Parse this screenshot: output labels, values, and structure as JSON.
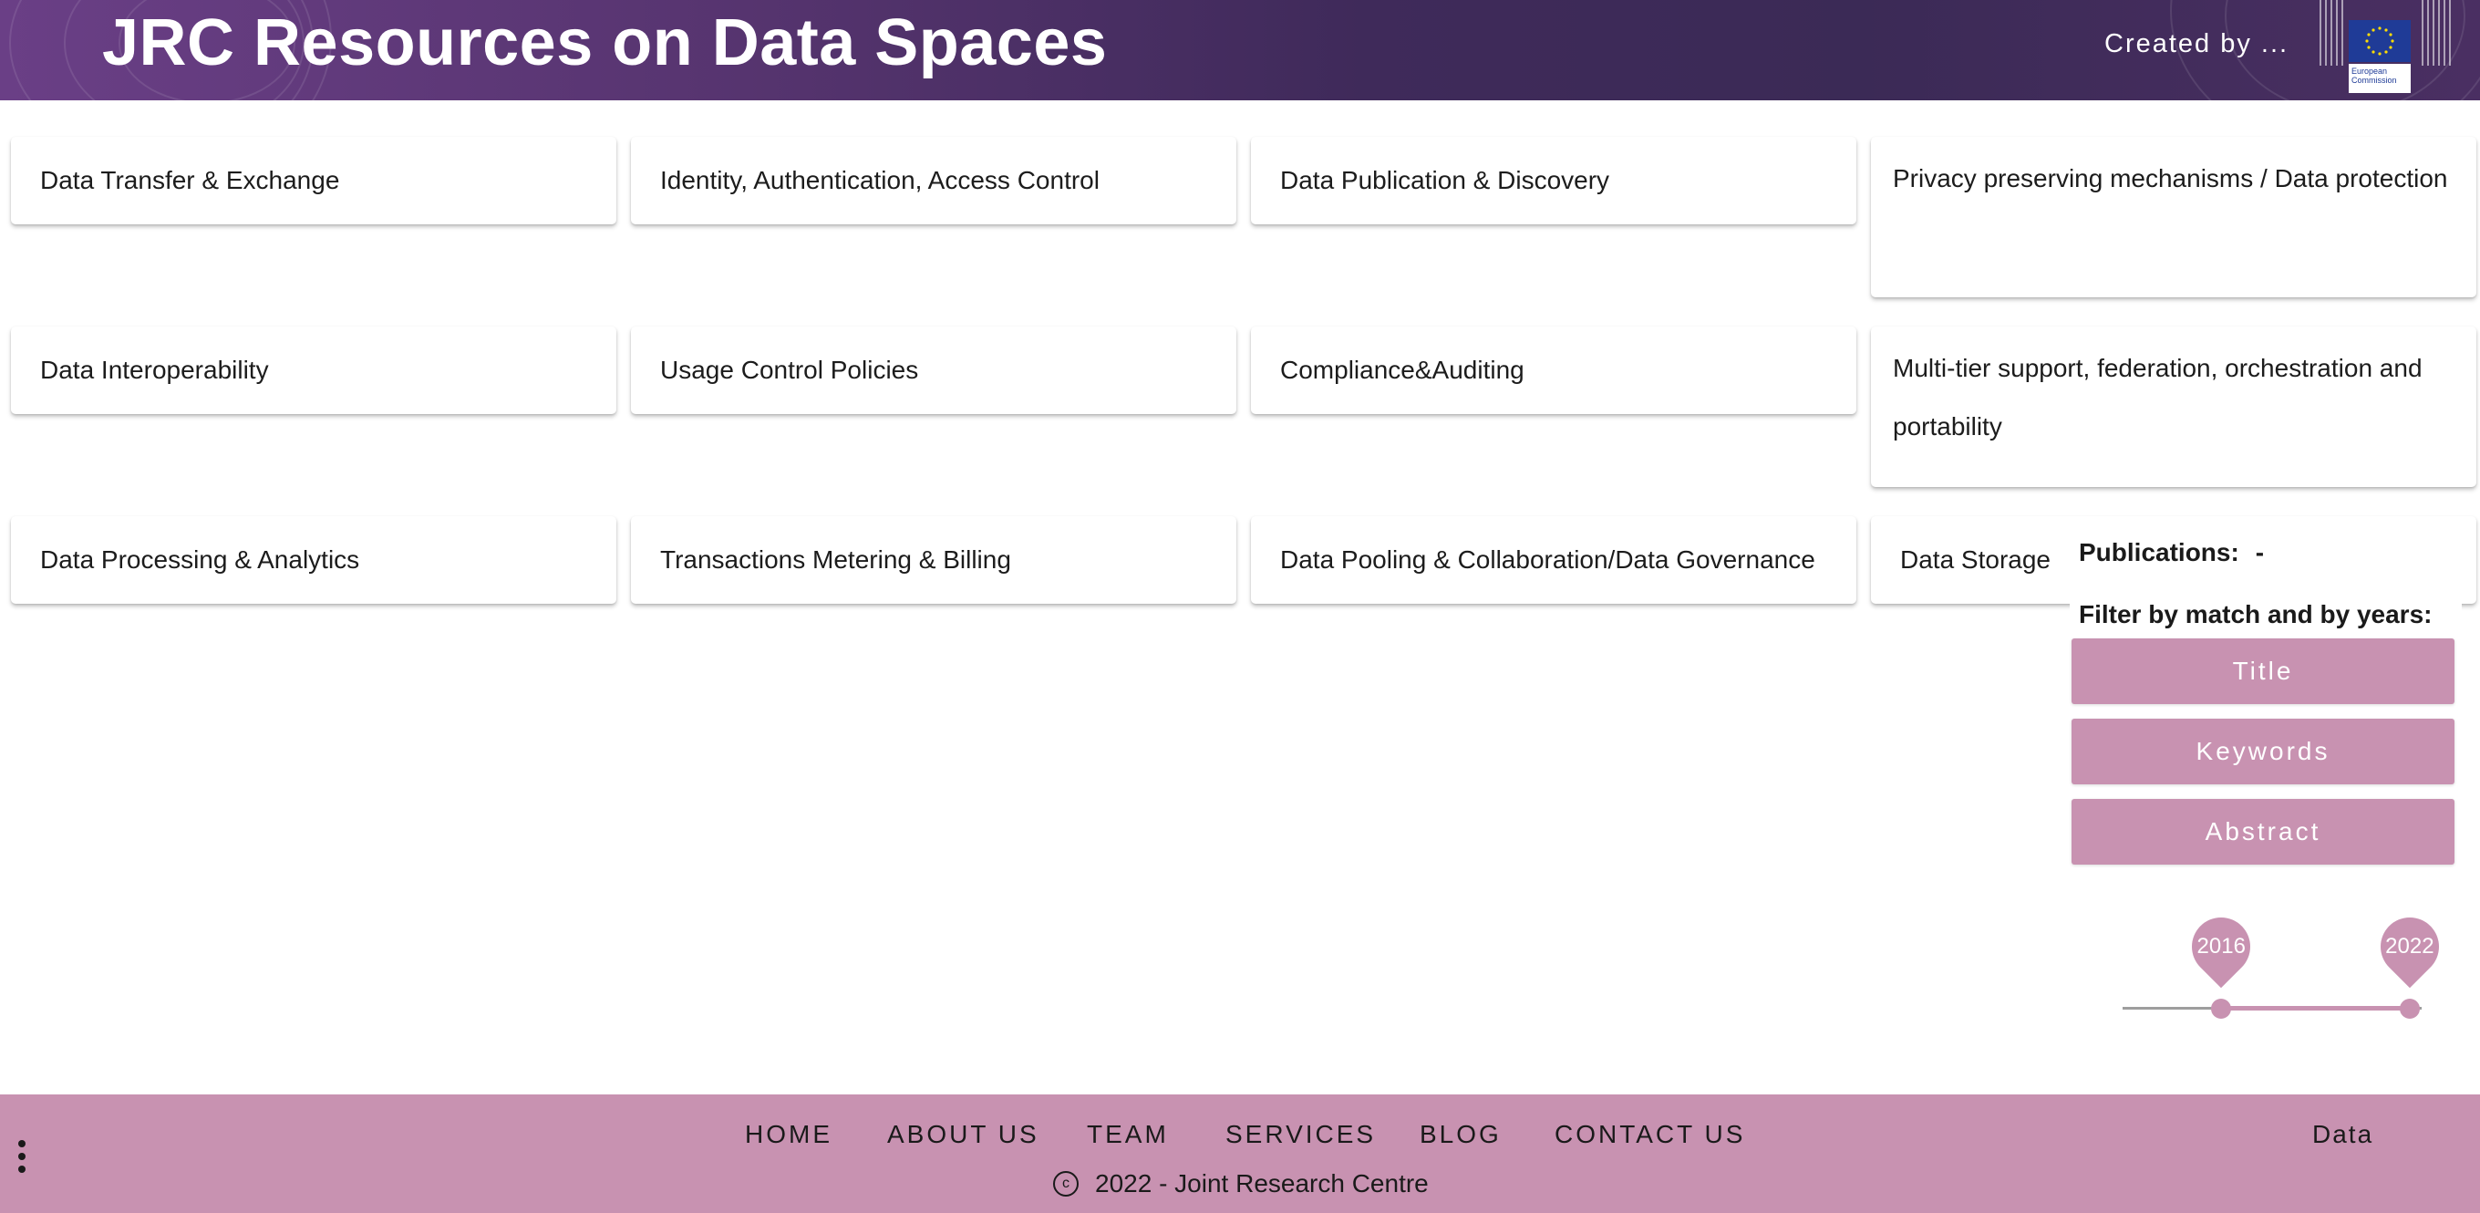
{
  "header": {
    "title": "JRC Resources on Data Spaces",
    "created_by": "Created by ...",
    "logo_text": "European Commission",
    "colors": {
      "gradient_start": "#6a3f86",
      "gradient_end": "#3b2a56"
    }
  },
  "cards": [
    "Data Transfer & Exchange",
    "Identity, Authentication, Access Control",
    "Data Publication & Discovery",
    "Privacy preserving mechanisms / Data protection",
    "Data Interoperability",
    "Usage Control Policies",
    "Compliance&Auditing",
    "Multi-tier support, federation, orchestration and portability",
    "Data Processing & Analytics",
    "Transactions Metering & Billing",
    "Data Pooling & Collaboration/Data Governance",
    "Data Storage"
  ],
  "filter_panel": {
    "publications_label": "Publications:",
    "publications_value": "-",
    "filter_label": "Filter by match and by years:",
    "buttons": [
      "Title",
      "Keywords",
      "Abstract"
    ],
    "year_slider": {
      "min_year": "2016",
      "max_year": "2022",
      "start_fraction": 0.33,
      "end_fraction": 0.96
    }
  },
  "footer": {
    "nav": [
      "HOME",
      "ABOUT US",
      "TEAM",
      "SERVICES",
      "BLOG",
      "CONTACT US"
    ],
    "copyright_symbol": "c",
    "copyright": "2022 - Joint Research Centre",
    "data_link": "Data"
  },
  "colors": {
    "accent": "#c892b1",
    "text": "#1a1a1a",
    "card_bg": "#ffffff"
  }
}
